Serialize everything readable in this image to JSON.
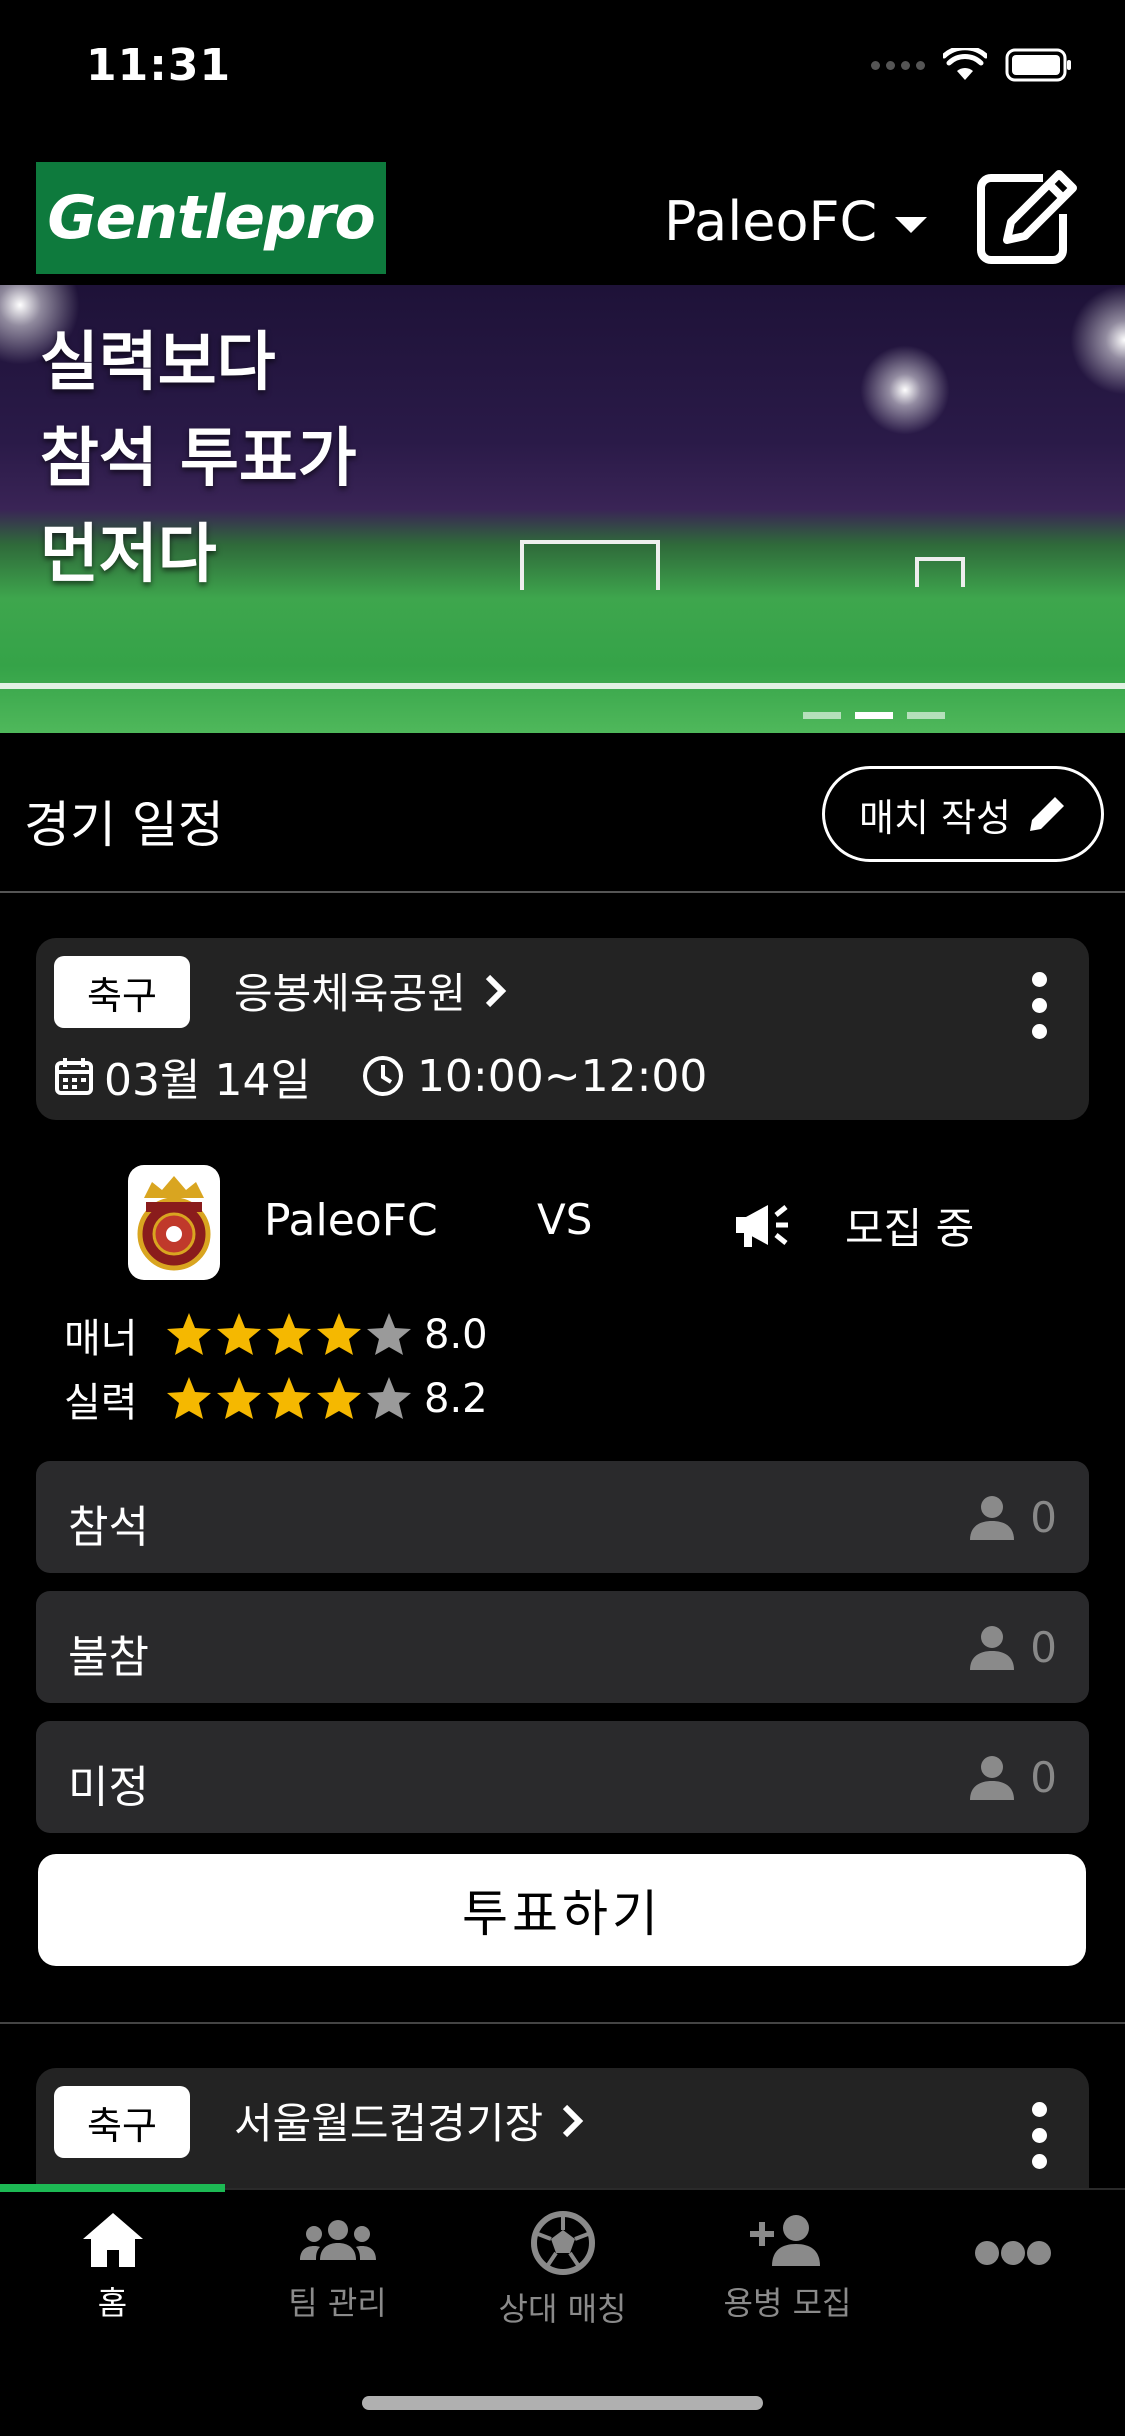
{
  "status_bar": {
    "time": "11:31"
  },
  "header": {
    "logo_text": "Gentlepro",
    "team_selector": "PaleoFC",
    "icons": {
      "dropdown": "caret-down-icon",
      "edit": "edit-square-icon"
    }
  },
  "banner": {
    "lines": [
      "실력보다",
      "참석 투표가",
      "먼저다"
    ],
    "slide_count": 3,
    "active_slide": 1
  },
  "schedule": {
    "title": "경기 일정",
    "write_match_label": "매치 작성"
  },
  "matches": [
    {
      "sport": "축구",
      "venue": "응봉체육공원",
      "date": "03월 14일",
      "time": "10:00~12:00",
      "home_team": "PaleoFC",
      "vs": "VS",
      "opponent_status": "모집 중",
      "ratings": [
        {
          "label": "매너",
          "stars": 4,
          "max": 5,
          "value": "8.0"
        },
        {
          "label": "실력",
          "stars": 4,
          "max": 5,
          "value": "8.2"
        }
      ],
      "votes": [
        {
          "label": "참석",
          "count": "0"
        },
        {
          "label": "불참",
          "count": "0"
        },
        {
          "label": "미정",
          "count": "0"
        }
      ],
      "vote_button": "투표하기"
    },
    {
      "sport": "축구",
      "venue": "서울월드컵경기장"
    }
  ],
  "tab_bar": {
    "tabs": [
      {
        "label": "홈",
        "icon": "home-icon",
        "active": true
      },
      {
        "label": "팀 관리",
        "icon": "team-icon",
        "active": false
      },
      {
        "label": "상대 매칭",
        "icon": "soccer-ball-icon",
        "active": false
      },
      {
        "label": "용병 모집",
        "icon": "add-user-icon",
        "active": false
      },
      {
        "label": "",
        "icon": "more-icon",
        "active": false
      }
    ]
  },
  "colors": {
    "background": "#000000",
    "logo_green": "#0e7a3d",
    "card": "#232323",
    "star": "#f5b800",
    "star_empty": "#9a9a9a",
    "progress": "#1db954"
  }
}
